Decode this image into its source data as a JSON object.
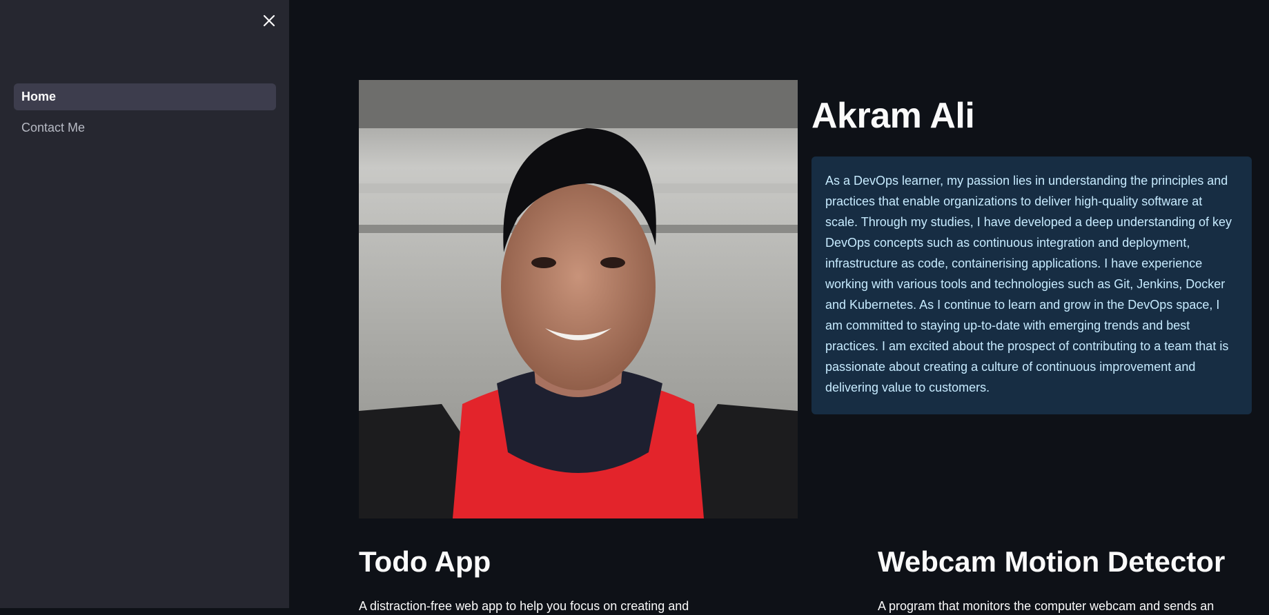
{
  "sidebar": {
    "items": [
      {
        "label": "Home",
        "active": true
      },
      {
        "label": "Contact Me",
        "active": false
      }
    ],
    "close_icon": "close-icon"
  },
  "profile": {
    "name": "Akram Ali",
    "photo_description": "portrait photo",
    "bio": "As a DevOps learner, my passion lies in understanding the principles and practices that enable organizations to deliver high-quality software at scale. Through my studies, I have developed a deep understanding of key DevOps concepts such as continuous integration and deployment, infrastructure as code, containerising applications. I have experience working with various tools and technologies such as Git, Jenkins, Docker and Kubernetes. As I continue to learn and grow in the DevOps space, I am committed to staying up-to-date with emerging trends and best practices. I am excited about the prospect of contributing to a team that is passionate about creating a culture of continuous improvement and delivering value to customers."
  },
  "projects": [
    {
      "title": "Todo App",
      "description": "A distraction-free web app to help you focus on creating and"
    },
    {
      "title": "Webcam Motion Detector",
      "description": "A program that monitors the computer webcam and sends an"
    }
  ],
  "colors": {
    "background": "#0e1117",
    "sidebar": "#262730",
    "info_box": "#172d43",
    "info_text": "#c7ebff"
  }
}
